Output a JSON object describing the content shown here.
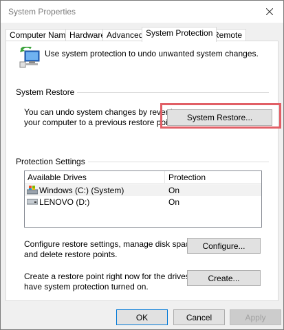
{
  "window": {
    "title": "System Properties"
  },
  "tabs": [
    {
      "label": "Computer Name"
    },
    {
      "label": "Hardware"
    },
    {
      "label": "Advanced"
    },
    {
      "label": "System Protection"
    },
    {
      "label": "Remote"
    }
  ],
  "intro": {
    "text": "Use system protection to undo unwanted system changes.",
    "icon": "system-protection-icon"
  },
  "system_restore": {
    "group_label": "System Restore",
    "description_line1": "You can undo system changes by reverting",
    "description_line2": "your computer to a previous restore point.",
    "button_label": "System Restore..."
  },
  "protection_settings": {
    "group_label": "Protection Settings",
    "columns": [
      "Available Drives",
      "Protection"
    ],
    "drives": [
      {
        "name": "Windows (C:) (System)",
        "protection": "On",
        "icon": "system-drive-icon",
        "selected": true
      },
      {
        "name": "LENOVO (D:)",
        "protection": "On",
        "icon": "drive-icon",
        "selected": false
      }
    ],
    "configure_text_line1": "Configure restore settings, manage disk space,",
    "configure_text_line2": "and delete restore points.",
    "configure_button": "Configure...",
    "create_text_line1": "Create a restore point right now for the drives that",
    "create_text_line2": "have system protection turned on.",
    "create_button": "Create..."
  },
  "footer": {
    "ok": "OK",
    "cancel": "Cancel",
    "apply": "Apply"
  },
  "colors": {
    "highlight": "#e15f66",
    "disabled_text": "#a0a0a0"
  }
}
